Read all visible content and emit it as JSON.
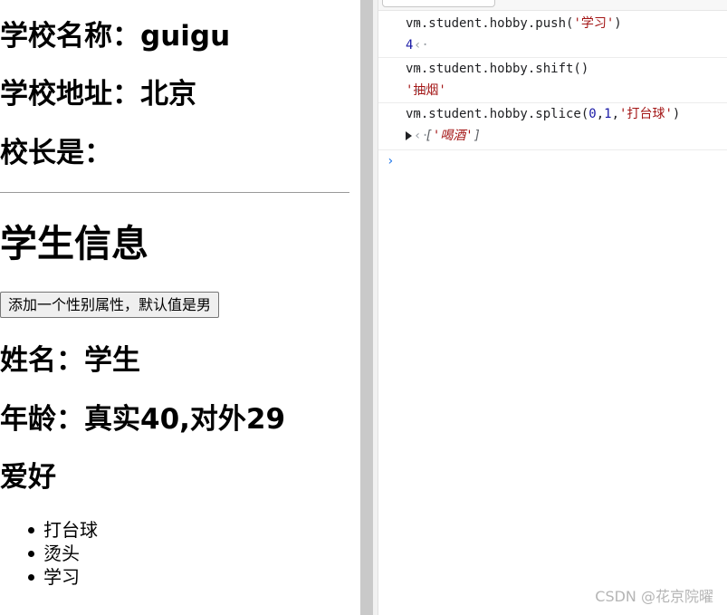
{
  "page": {
    "school_name_line": "学校名称：guigu",
    "school_address_line": "学校地址：北京",
    "principal_line": "校长是：",
    "student_info_title": "学生信息",
    "add_gender_button_label": "添加一个性别属性，默认值是男",
    "student_name_line": "姓名：学生",
    "student_age_line": "年龄：真实40,对外29",
    "hobby_title": "爱好",
    "hobbies": [
      "打台球",
      "烫头",
      "学习"
    ]
  },
  "console": {
    "entries": [
      {
        "command_prefix": "vm.student.hobby.push(",
        "command_arg_string": "'学习'",
        "command_suffix": ")",
        "result_kind": "number",
        "result_text": "4"
      },
      {
        "command_prefix": "vm.student.hobby.shift()",
        "result_kind": "string",
        "result_text": "'抽烟'"
      },
      {
        "command_prefix": "vm.student.hobby.splice(",
        "command_arg_0": "0",
        "command_comma_1": ",",
        "command_arg_1": "1",
        "command_comma_2": ",",
        "command_arg_2": "'打台球'",
        "command_suffix": ")",
        "result_kind": "array",
        "result_open": "[",
        "result_item": "'喝酒'",
        "result_close": "]"
      }
    ],
    "prompt_symbol": "›"
  },
  "watermark": {
    "text": "CSDN @花京院曜"
  },
  "colors": {
    "splitter": "#c9c9c9",
    "console_string": "#a31515",
    "console_number": "#1a1aa6",
    "console_prompt": "#1a73e8",
    "console_muted": "#7a7a7a"
  },
  "icons": {
    "console_gutter_input": "chevron-right-icon",
    "console_gutter_result": "back-arrow-icon",
    "array_expander": "triangle-right-icon",
    "console_prompt": "chevron-right-icon"
  }
}
